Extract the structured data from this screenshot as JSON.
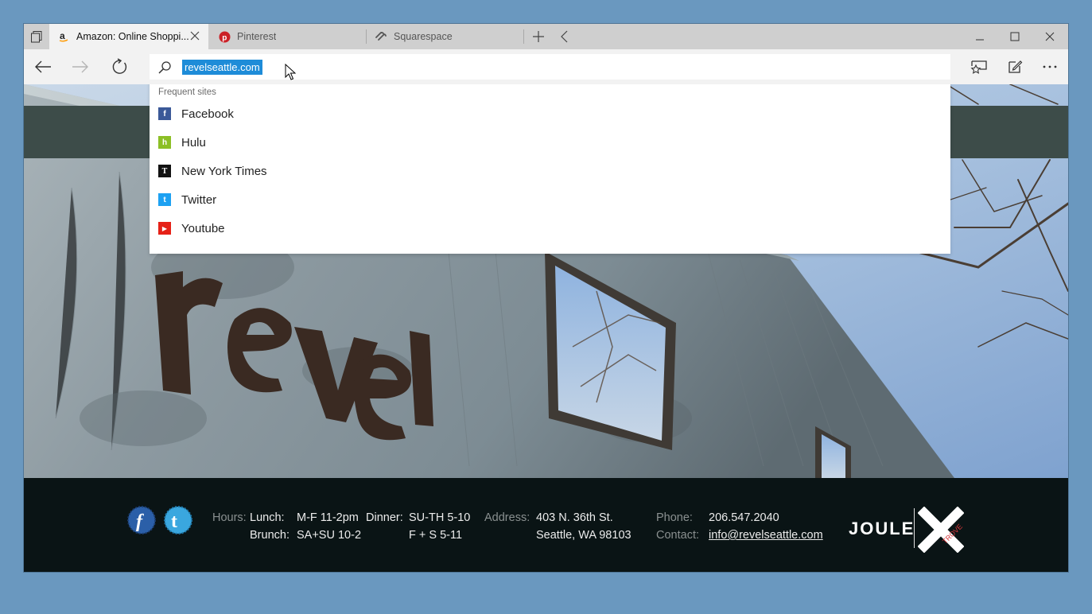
{
  "tabs": [
    {
      "title": "Amazon: Online Shoppi...",
      "icon": "amazon-icon",
      "active": true
    },
    {
      "title": "Pinterest",
      "icon": "pinterest-icon",
      "active": false
    },
    {
      "title": "Squarespace",
      "icon": "squarespace-icon",
      "active": false
    }
  ],
  "address": {
    "url": "revelseattle.com"
  },
  "dropdown": {
    "heading": "Frequent sites",
    "items": [
      {
        "label": "Facebook",
        "icon": "facebook-icon",
        "glyph": "f",
        "color": "#3b5998"
      },
      {
        "label": "Hulu",
        "icon": "hulu-icon",
        "glyph": "h",
        "color": "#8cbf26"
      },
      {
        "label": "New York Times",
        "icon": "nyt-icon",
        "glyph": "T",
        "color": "#111111"
      },
      {
        "label": "Twitter",
        "icon": "twitter-icon",
        "glyph": "t",
        "color": "#1da1f2"
      },
      {
        "label": "Youtube",
        "icon": "youtube-icon",
        "glyph": "▶",
        "color": "#e62117"
      }
    ]
  },
  "footer": {
    "hours_label": "Hours:",
    "lunch_label": "Lunch:",
    "lunch_value": "M-F 11-2pm",
    "dinner_label": "Dinner:",
    "dinner_value1": "SU-TH 5-10",
    "brunch_label": "Brunch:",
    "brunch_value": "SA+SU 10-2",
    "dinner_value2": "F + S 5-11",
    "address_label": "Address:",
    "address_line1": "403 N. 36th St.",
    "address_line2": "Seattle, WA 98103",
    "phone_label": "Phone:",
    "phone_value": "206.547.2040",
    "contact_label": "Contact:",
    "contact_value": "info@revelseattle.com",
    "brand": "JOULE",
    "brand_x_text": "TROVE"
  },
  "colors": {
    "accent_selection": "#1e8cd8",
    "desktop": "#6a98bf",
    "footer_bg": "#0a1415",
    "trove_red": "#d6363a"
  }
}
